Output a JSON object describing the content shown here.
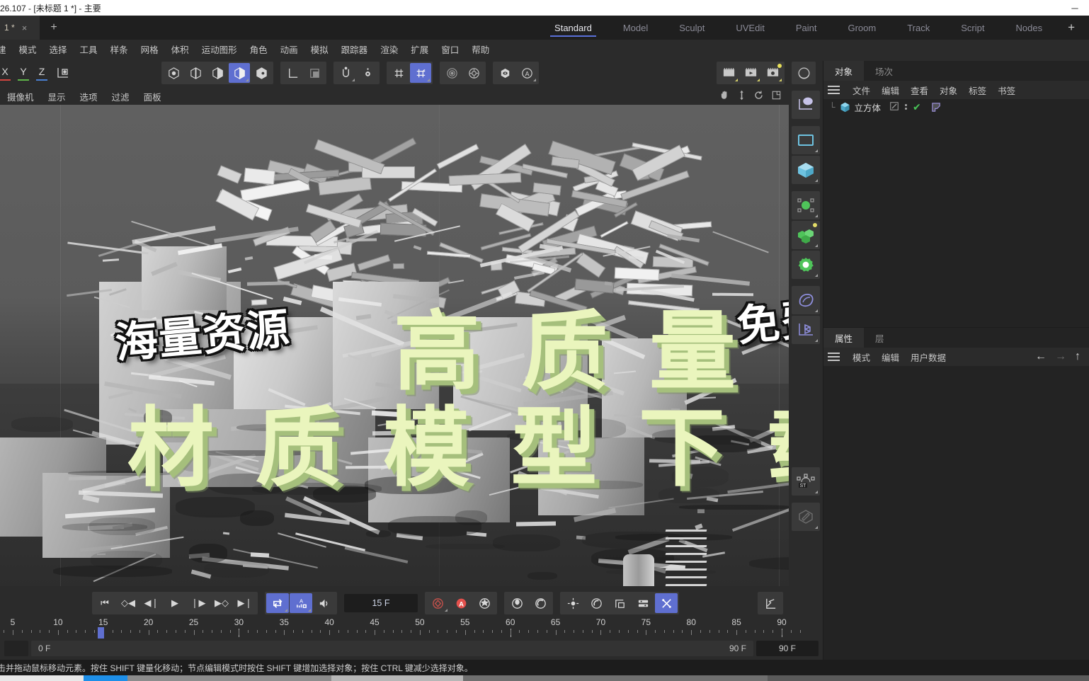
{
  "window": {
    "title": "26.107 - [未标题 1 *] - 主要",
    "minimize": "─",
    "doc_tab": "1 *",
    "doc_tab_close": "×",
    "new_tab": "+"
  },
  "layout_tabs": [
    {
      "label": "Standard",
      "active": true
    },
    {
      "label": "Model",
      "active": false
    },
    {
      "label": "Sculpt",
      "active": false
    },
    {
      "label": "UVEdit",
      "active": false
    },
    {
      "label": "Paint",
      "active": false
    },
    {
      "label": "Groom",
      "active": false
    },
    {
      "label": "Track",
      "active": false
    },
    {
      "label": "Script",
      "active": false
    },
    {
      "label": "Nodes",
      "active": false
    }
  ],
  "layout_tabs_add": "+",
  "menubar": [
    "建",
    "模式",
    "选择",
    "工具",
    "样条",
    "网格",
    "体积",
    "运动图形",
    "角色",
    "动画",
    "模拟",
    "跟踪器",
    "渲染",
    "扩展",
    "窗口",
    "帮助"
  ],
  "toolbar": {
    "axes": [
      {
        "label": "X",
        "color": "#d2453f"
      },
      {
        "label": "Y",
        "color": "#5fb54a"
      },
      {
        "label": "Z",
        "color": "#4a7fd0"
      }
    ],
    "axis_system_icon": "world-axis-icon",
    "modes": [
      {
        "name": "point-mode-icon",
        "active": false
      },
      {
        "name": "edge-mode-icon",
        "active": false
      },
      {
        "name": "polygon-mode-icon",
        "active": false
      },
      {
        "name": "model-mode-icon",
        "active": true
      },
      {
        "name": "object-mode-icon",
        "active": false
      }
    ],
    "coord_icons": [
      {
        "name": "axis-local-icon"
      },
      {
        "name": "object-axis-icon"
      }
    ],
    "snap_icons": [
      {
        "name": "snap-magnet-icon"
      },
      {
        "name": "snap-settings-icon"
      }
    ],
    "grid_icons": [
      {
        "name": "workplane-grid-icon",
        "active": false
      },
      {
        "name": "quantize-icon",
        "active": true
      }
    ],
    "view_icons": [
      {
        "name": "viewport-target-icon"
      },
      {
        "name": "viewport-render-region-icon"
      }
    ],
    "visibility_icons": [
      {
        "name": "visibility-eye-icon"
      },
      {
        "name": "annotation-a-icon"
      }
    ],
    "render_icons": [
      {
        "name": "render-view-icon"
      },
      {
        "name": "render-picture-viewer-icon"
      },
      {
        "name": "render-settings-icon"
      }
    ],
    "material_icon": "material-sphere-icon"
  },
  "viewport": {
    "menu": [
      "摄像机",
      "显示",
      "选项",
      "过滤",
      "面板"
    ],
    "nav_icons": [
      "pan-hand-icon",
      "dolly-icon",
      "rotate-icon",
      "maximize-view-icon"
    ],
    "overlay_text": {
      "top_left": "海量资源",
      "top_right": "免费网站",
      "headline_1": "高 质 量",
      "headline_2": "材 质 模 型 下 载 站",
      "headline_color": "#eaf5bd",
      "headline_shadow_color": "#a5bf7c"
    }
  },
  "right_tools": [
    {
      "name": "axis-handle-icon",
      "color": "#c6c2e8"
    },
    {
      "name": "rectangle-spline-icon",
      "color": "#6ec2e0"
    },
    {
      "name": "cube-primitive-icon",
      "color": "#6ec2e0"
    },
    {
      "name": "null-object-icon",
      "color": "#4fc45a"
    },
    {
      "name": "mograph-cloner-icon",
      "color": "#4fc45a"
    },
    {
      "name": "effector-gear-icon",
      "color": "#4fc45a"
    },
    {
      "name": "deformer-bend-icon",
      "color": "#8e8edc"
    },
    {
      "name": "environment-axis-icon",
      "color": "#8e8edc"
    },
    {
      "name": "simulation-tag-icon",
      "color": "#d0d0d0",
      "label": "ST"
    },
    {
      "name": "edit-pencil-icon",
      "color": "#7a7a7a"
    }
  ],
  "object_manager": {
    "tabs": [
      {
        "label": "对象",
        "active": true
      },
      {
        "label": "场次",
        "active": false
      }
    ],
    "menu": [
      "文件",
      "编辑",
      "查看",
      "对象",
      "标签",
      "书签"
    ],
    "objects": [
      {
        "name": "立方体",
        "icon": "cube-object-icon",
        "edit_icon": "edit-visibility-icon",
        "check_icon": "enabled-check-icon",
        "tag_icon": "phong-tag-icon"
      }
    ]
  },
  "attribute_manager": {
    "tabs": [
      {
        "label": "属性",
        "active": true
      },
      {
        "label": "层",
        "active": false
      }
    ],
    "menu": [
      "模式",
      "编辑",
      "用户数据"
    ],
    "nav": [
      "←",
      "→",
      "↑"
    ]
  },
  "timeline": {
    "transport": [
      {
        "name": "go-to-start-button",
        "glyph": "⏮"
      },
      {
        "name": "prev-key-button",
        "glyph": "◇◀"
      },
      {
        "name": "step-back-button",
        "glyph": "◀❘"
      },
      {
        "name": "play-button",
        "glyph": "▶"
      },
      {
        "name": "step-forward-button",
        "glyph": "❘▶"
      },
      {
        "name": "next-key-button",
        "glyph": "▶◇"
      },
      {
        "name": "go-to-end-button",
        "glyph": "▶❘"
      }
    ],
    "options": [
      {
        "name": "loop-playback-button",
        "active": true
      },
      {
        "name": "auto-key-button",
        "active": true
      },
      {
        "name": "sound-button",
        "active": false
      }
    ],
    "current_frame": "15 F",
    "record_buttons": [
      {
        "name": "record-keyframe-button",
        "active": false
      },
      {
        "name": "autokeying-button",
        "active": false
      },
      {
        "name": "keyframe-selection-button",
        "active": false
      }
    ],
    "mode_buttons": [
      {
        "name": "point-level-animation-button",
        "active": false
      },
      {
        "name": "animation-mode-button",
        "active": false
      }
    ],
    "channel_buttons": [
      {
        "name": "position-key-button",
        "active": false
      },
      {
        "name": "rotation-key-button",
        "active": false
      },
      {
        "name": "scale-key-button",
        "active": false
      },
      {
        "name": "parameter-key-button",
        "active": false
      },
      {
        "name": "pla-key-button",
        "active": true
      }
    ],
    "graph_button": {
      "name": "timeline-graph-button"
    },
    "ruler_labels": [
      "5",
      "10",
      "15",
      "20",
      "25",
      "30",
      "35",
      "40",
      "45",
      "50",
      "55",
      "60",
      "65",
      "70",
      "75",
      "80",
      "85",
      "90"
    ],
    "playhead_frame": "15",
    "range_start": "0 F",
    "range_end": "90 F",
    "max_frame_field": "90 F"
  },
  "statusbar": {
    "message": "击并拖动鼠标移动元素。按住 SHIFT 键量化移动；节点编辑模式时按住 SHIFT 键增加选择对象；按住 CTRL 键减少选择对象。"
  },
  "colors": {
    "accent_blue": "#5f6fd0",
    "panel_bg": "#2b2b2b",
    "dark_bg": "#232323",
    "check_green": "#49c457"
  }
}
